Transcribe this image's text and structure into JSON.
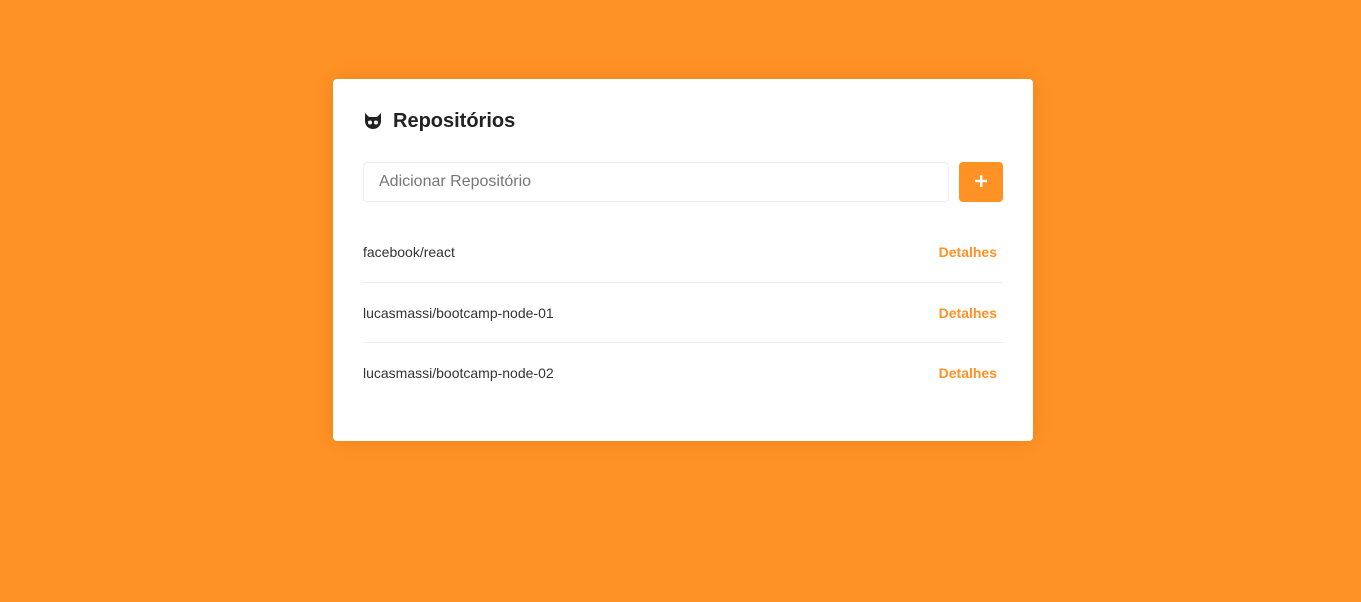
{
  "colors": {
    "background": "#ff9224",
    "accent": "#ff9224",
    "card": "#ffffff"
  },
  "header": {
    "icon": "github-icon",
    "title": "Repositórios"
  },
  "form": {
    "placeholder": "Adicionar Repositório",
    "value": "",
    "add_icon": "plus-icon"
  },
  "repositories": [
    {
      "name": "facebook/react",
      "action": "Detalhes"
    },
    {
      "name": "lucasmassi/bootcamp-node-01",
      "action": "Detalhes"
    },
    {
      "name": "lucasmassi/bootcamp-node-02",
      "action": "Detalhes"
    }
  ]
}
